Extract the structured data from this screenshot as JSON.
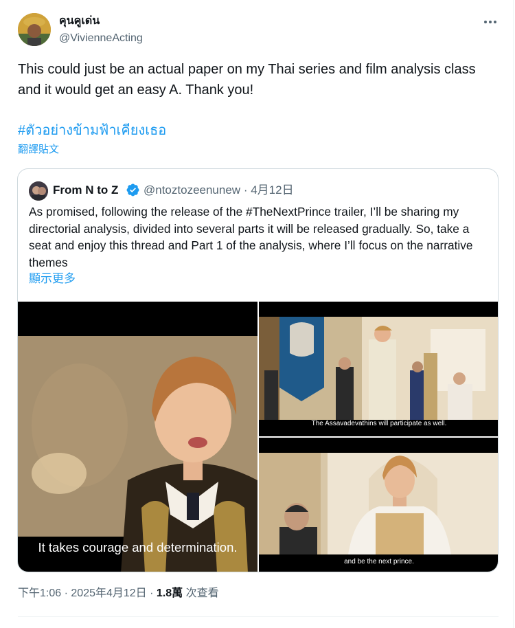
{
  "author": {
    "name": "คุนคูเด่น",
    "handle": "@VivienneActing"
  },
  "tweet": {
    "text": "This could just be an actual paper on my Thai series and film analysis class and it would get an easy A. Thank you!",
    "hashtag": "#ตัวอย่างข้ามฟ้าเคียงเธอ",
    "translate_label": "翻譯貼文"
  },
  "quote": {
    "name": "From N to Z",
    "handle": "@ntoztozeenunew",
    "separator": "·",
    "date": "4月12日",
    "text": "As promised, following the release of the #TheNextPrince trailer, I’ll be sharing my directorial analysis, divided into several parts it will be released gradually. So, take a seat and enjoy this thread and Part 1 of the analysis, where I’ll focus on the narrative themes",
    "show_more_label": "顯示更多",
    "media": [
      {
        "subtitle": "It takes courage and determination."
      },
      {
        "subtitle": "The Assavadevathins will participate as well."
      },
      {
        "subtitle": "and be the next prince."
      }
    ]
  },
  "footer": {
    "time": "下午1:06",
    "separator": "·",
    "date": "2025年4月12日",
    "views_count": "1.8萬",
    "views_label": "次查看"
  },
  "icons": {
    "more": "more-horizontal-icon",
    "verified": "verified-badge-icon"
  },
  "colors": {
    "link": "#1d9bf0",
    "secondary_text": "#536471",
    "primary_text": "#0f1419",
    "border": "#cfd9de"
  }
}
